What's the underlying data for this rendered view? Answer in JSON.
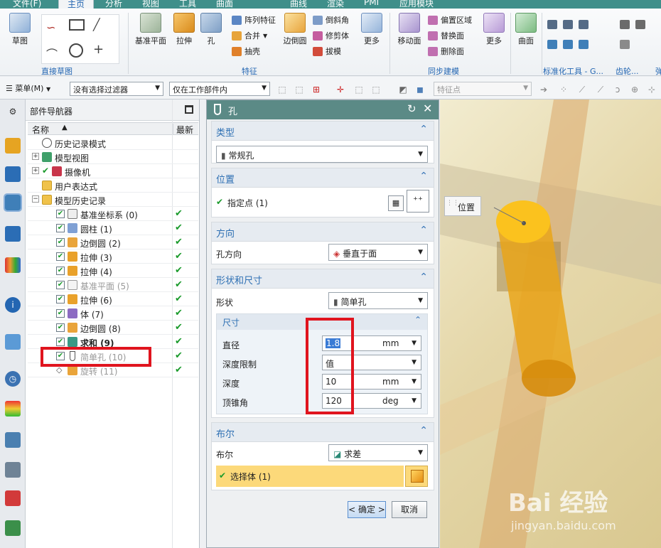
{
  "tabs": [
    "文件(F)",
    "主页",
    "分析",
    "视图",
    "工具",
    "曲面",
    "曲线",
    "渲染",
    "PMI",
    "应用模块"
  ],
  "active_tab": "主页",
  "ribbon": {
    "sketch": "草图",
    "sketch_group": "直接草图",
    "datum_plane": "基准平面",
    "extrude": "拉伸",
    "hole": "孔",
    "pattern_feature": "阵列特征",
    "unite": "合并",
    "shell": "抽壳",
    "edge_blend": "边倒圆",
    "chamfer": "倒斜角",
    "trim_body": "修剪体",
    "draft": "拔模",
    "more1": "更多",
    "feature_group": "特征",
    "move_face": "移动面",
    "offset_region": "偏置区域",
    "replace_face": "替换面",
    "delete_face": "删除面",
    "more2": "更多",
    "sync_group": "同步建模",
    "surface": "曲面",
    "std_tools_group": "标准化工具 - G...",
    "gear_group": "齿轮...",
    "spring_group": "弹"
  },
  "toolbar2": {
    "menu": "菜单(M)",
    "filter": "没有选择过滤器",
    "scope": "仅在工作部件内",
    "snap": "特征点"
  },
  "navigator": {
    "title": "部件导航器",
    "col_name": "名称",
    "col_latest": "最新",
    "rows": [
      {
        "label": "历史记录模式",
        "latest": ""
      },
      {
        "label": "模型视图",
        "latest": ""
      },
      {
        "label": "摄像机",
        "latest": ""
      },
      {
        "label": "用户表达式",
        "latest": ""
      },
      {
        "label": "模型历史记录",
        "latest": ""
      },
      {
        "label": "基准坐标系 (0)",
        "latest": "✔"
      },
      {
        "label": "圆柱 (1)",
        "latest": "✔"
      },
      {
        "label": "边倒圆 (2)",
        "latest": "✔"
      },
      {
        "label": "拉伸 (3)",
        "latest": "✔"
      },
      {
        "label": "拉伸 (4)",
        "latest": "✔"
      },
      {
        "label": "基准平面 (5)",
        "latest": "✔"
      },
      {
        "label": "拉伸 (6)",
        "latest": "✔"
      },
      {
        "label": "体 (7)",
        "latest": "✔"
      },
      {
        "label": "边倒圆 (8)",
        "latest": "✔"
      },
      {
        "label": "求和 (9)",
        "latest": "✔"
      },
      {
        "label": "简单孔 (10)",
        "latest": "✔"
      },
      {
        "label": "旋转 (11)",
        "latest": "✔"
      }
    ]
  },
  "dialog": {
    "title": "孔",
    "type_section": "类型",
    "type_value": "常规孔",
    "position_section": "位置",
    "specify_point": "指定点 (1)",
    "direction_section": "方向",
    "hole_direction_label": "孔方向",
    "hole_direction_value": "垂直于面",
    "shape_section": "形状和尺寸",
    "form_label": "形状",
    "form_value": "简单孔",
    "dimensions_section": "尺寸",
    "diameter_label": "直径",
    "diameter_value": "1.8",
    "diameter_unit": "mm",
    "depth_limit_label": "深度限制",
    "depth_limit_value": "值",
    "depth_label": "深度",
    "depth_value": "10",
    "depth_unit": "mm",
    "tip_angle_label": "顶锥角",
    "tip_angle_value": "120",
    "tip_angle_unit": "deg",
    "boolean_section": "布尔",
    "boolean_label": "布尔",
    "boolean_value": "求差",
    "select_body": "选择体 (1)",
    "ok_button": "< 确定 >",
    "cancel_button": "取消"
  },
  "viewport": {
    "position_tag": "位置",
    "watermark_main": "Bai  经验",
    "watermark_url": "jingyan.baidu.com"
  },
  "colors": {
    "title_teal": "#5b8a86",
    "accent_blue": "#2d6fb3",
    "check_green": "#1a9a2b",
    "highlight_red": "#e0141e",
    "select_yellow": "#fcd97a",
    "cylinder_orange": "#e9a419"
  }
}
